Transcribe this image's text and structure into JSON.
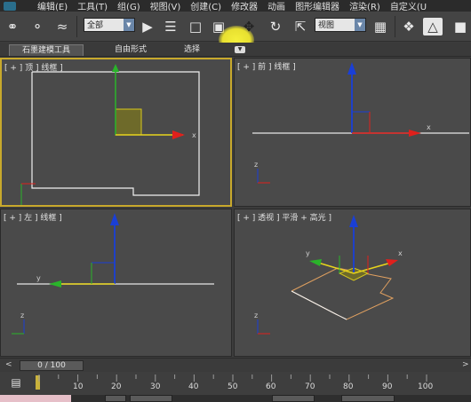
{
  "menu": {
    "items": [
      "编辑(E)",
      "工具(T)",
      "组(G)",
      "视图(V)",
      "创建(C)",
      "修改器",
      "动画",
      "图形编辑器",
      "渲染(R)",
      "自定义(U"
    ]
  },
  "toolbar": {
    "selection_filter": "全部",
    "reference_coord": "视图"
  },
  "ribbon": {
    "tabs": [
      "石墨建模工具",
      "自由形式",
      "选择"
    ]
  },
  "viewports": {
    "top": {
      "label": "[ + ] 顶 ] 线框 ]"
    },
    "front": {
      "label": "[ + ] 前 ] 线框 ]"
    },
    "left": {
      "label": "[ + ] 左 ] 线框 ]"
    },
    "perspective": {
      "label": "[ + ] 透视 ] 平滑 + 高光 ]"
    }
  },
  "gizmo": {
    "x": "x",
    "y": "y",
    "z": "z"
  },
  "timeline": {
    "frame_display": "0 / 100",
    "prev": "<",
    "next": ">",
    "ticks": [
      "10",
      "20",
      "30",
      "40",
      "50",
      "60",
      "70",
      "80",
      "90",
      "100"
    ]
  },
  "status": {
    "field1": "",
    "field2": "",
    "field3": ""
  },
  "colors": {
    "axis_x": "#e0201c",
    "axis_y": "#2ab42a",
    "axis_z": "#1a3fd6",
    "gizmo_yellow": "#e8d41c",
    "active_border": "#c8a92c",
    "highlight": "#f4ef3a"
  }
}
